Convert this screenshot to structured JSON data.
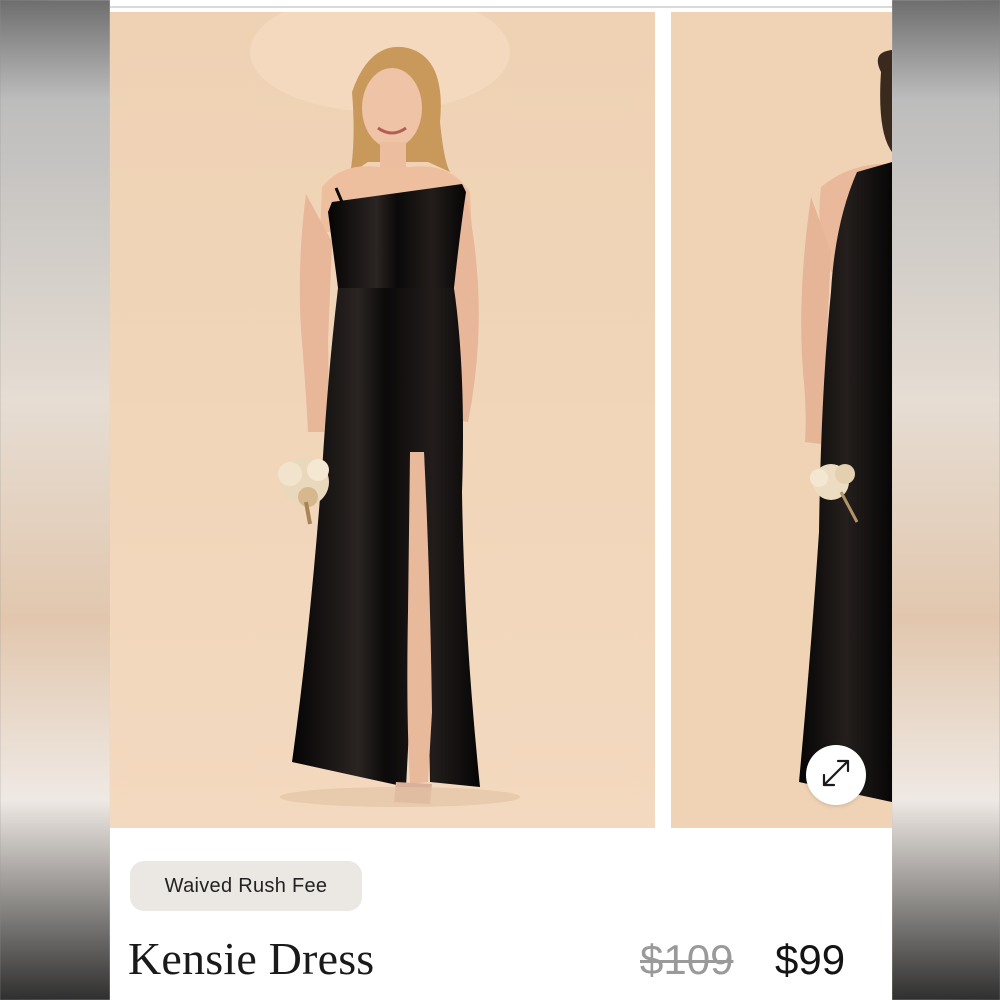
{
  "product": {
    "badge": "Waived Rush Fee",
    "name": "Kensie Dress",
    "original_price": "$109",
    "sale_price": "$99"
  },
  "gallery": {
    "expand_icon": "expand-arrows-icon"
  },
  "colors": {
    "photo_background": "#f1d5b8",
    "dress": "#0c0a0a",
    "badge_background": "#ebe7e3"
  }
}
